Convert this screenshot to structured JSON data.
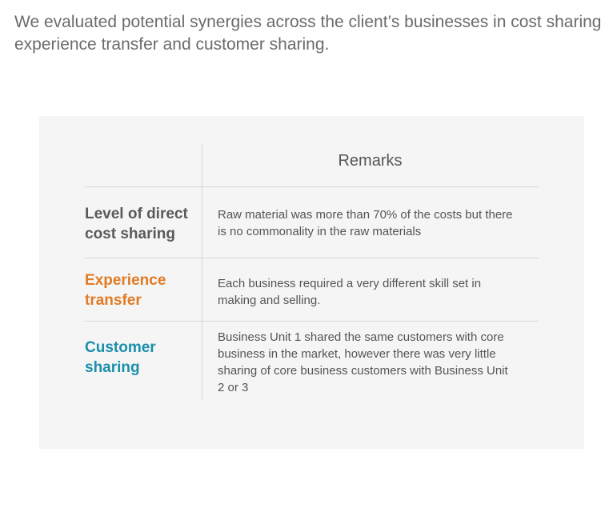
{
  "intro": {
    "line1": "We evaluated potential synergies across the client’s businesses in cost sharing,",
    "line2": "experience transfer and customer sharing."
  },
  "table": {
    "header": "Remarks",
    "rows": [
      {
        "label_line1": "Level of direct",
        "label_line2": "cost sharing",
        "remark_lines": [
          "Raw material was more than 70% of the costs but there",
          "is no commonality in the raw materials"
        ]
      },
      {
        "label_line1": "Experience",
        "label_line2": "transfer",
        "remark_lines": [
          "Each business required a very different skill set in",
          "making and selling."
        ]
      },
      {
        "label_line1": "Customer",
        "label_line2": "sharing",
        "remark_lines": [
          "Business Unit 1 shared the same customers with core",
          "business in the market, however there was very little",
          "sharing of core business customers with Business Unit",
          "2 or 3"
        ]
      }
    ]
  },
  "colors": {
    "row1_label": "#5a5a5a",
    "row2_label": "#e07b24",
    "row3_label": "#1b8fab",
    "panel_bg": "#f5f5f5",
    "divider": "#d8d8d8"
  }
}
